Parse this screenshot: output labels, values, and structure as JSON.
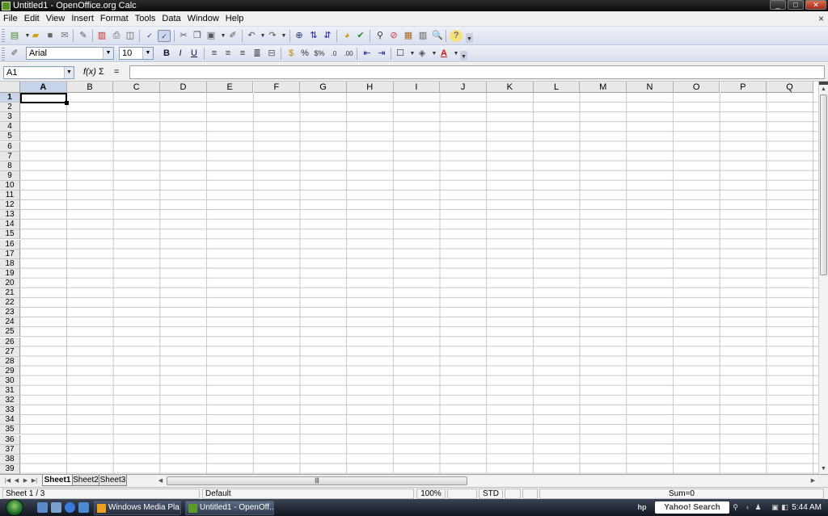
{
  "window": {
    "title": "Untitled1 - OpenOffice.org Calc",
    "btn_min": "_",
    "btn_max": "□",
    "btn_close": "✕"
  },
  "menu": [
    "File",
    "Edit",
    "View",
    "Insert",
    "Format",
    "Tools",
    "Data",
    "Window",
    "Help"
  ],
  "menu_close": "×",
  "toolbar2": {
    "font_name": "Arial",
    "font_size": "10",
    "bold": "B",
    "italic": "I",
    "underline": "U"
  },
  "formula_bar": {
    "name_box": "A1",
    "fx": "f(x)",
    "sum": "Σ",
    "equals": "=",
    "value": ""
  },
  "columns": [
    "A",
    "B",
    "C",
    "D",
    "E",
    "F",
    "G",
    "H",
    "I",
    "J",
    "K",
    "L",
    "M",
    "N",
    "O",
    "P",
    "Q"
  ],
  "rows": [
    "1",
    "2",
    "3",
    "4",
    "5",
    "6",
    "7",
    "8",
    "9",
    "10",
    "11",
    "12",
    "13",
    "14",
    "15",
    "16",
    "17",
    "18",
    "19",
    "20",
    "21",
    "22",
    "23",
    "24",
    "25",
    "26",
    "27",
    "28",
    "29",
    "30",
    "31",
    "32",
    "33",
    "34",
    "35",
    "36",
    "37",
    "38",
    "39"
  ],
  "sheets": [
    "Sheet1",
    "Sheet2",
    "Sheet3"
  ],
  "status": {
    "sheet": "Sheet 1 / 3",
    "style": "Default",
    "zoom": "100%",
    "mode": "STD",
    "sum": "Sum=0"
  },
  "taskbar": {
    "tasks": [
      "Windows Media Pla...",
      "Untitled1 - OpenOff..."
    ],
    "search": "Yahoo! Search",
    "clock": "5:44 AM"
  },
  "colors": {
    "titlebar": "#0a0a0a",
    "active_header": "#c6d3e8",
    "grid": "#c8c8c8"
  }
}
